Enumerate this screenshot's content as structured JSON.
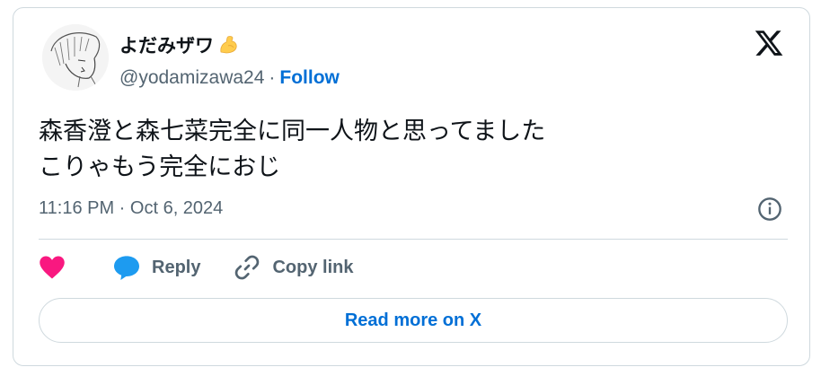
{
  "tweet": {
    "author": {
      "display_name": "よだみザワ",
      "emoji": "flexed-biceps-emoji",
      "handle": "@yodamizawa24",
      "separator": "·",
      "follow_label": "Follow",
      "avatar": "sketched-portrait-avatar"
    },
    "text": "森香澄と森七菜完全に同一人物と思ってました\nこりゃもう完全におじ",
    "timestamp": "11:16 PM · Oct 6, 2024",
    "logo": "x-logo-icon",
    "info_icon": "info-icon",
    "actions": {
      "like_icon": "heart-icon",
      "reply_label": "Reply",
      "reply_icon": "speech-bubble-icon",
      "copy_link_label": "Copy link",
      "copy_link_icon": "link-icon"
    },
    "read_more_label": "Read more on X"
  },
  "colors": {
    "link_blue": "#006fd6",
    "heart_pink": "#f91880",
    "reply_blue": "#1d9bf0",
    "secondary_text": "#536471",
    "border": "#cfd9de"
  }
}
